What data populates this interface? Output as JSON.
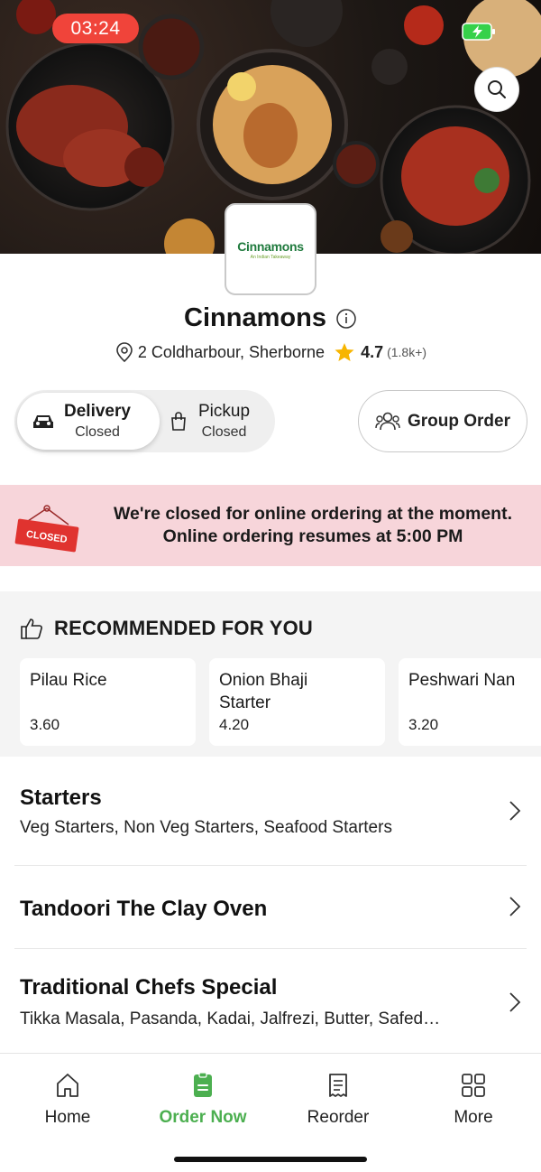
{
  "status_bar": {
    "time": "03:24",
    "battery_icon": "battery-charging-icon",
    "battery_color": "#36d14a"
  },
  "hero": {
    "search_icon": "search-icon"
  },
  "restaurant": {
    "logo_text": "Cinnamons",
    "logo_tagline": "An Indian Takeaway",
    "name": "Cinnamons",
    "address": "2 Coldharbour, Sherborne",
    "rating": "4.7",
    "rating_count": "(1.8k+)",
    "rating_star_color": "#f7b500"
  },
  "order_mode": {
    "delivery": {
      "title": "Delivery",
      "status": "Closed",
      "selected": true
    },
    "pickup": {
      "title": "Pickup",
      "status": "Closed",
      "selected": false
    },
    "group_order_label": "Group Order"
  },
  "closed_banner": {
    "sign_text": "CLOSED",
    "line1": "We're closed for online ordering at the moment.",
    "line2": "Online ordering resumes at 5:00 PM",
    "background": "#f7d5da"
  },
  "recommended": {
    "heading": "RECOMMENDED FOR YOU",
    "items": [
      {
        "name": "Pilau Rice",
        "price": "3.60"
      },
      {
        "name": "Onion Bhaji Starter",
        "price": "4.20"
      },
      {
        "name": "Peshwari Nan",
        "price": "3.20"
      }
    ]
  },
  "categories": [
    {
      "title": "Starters",
      "subtitle": "Veg Starters, Non Veg Starters, Seafood Starters"
    },
    {
      "title": "Tandoori The Clay Oven",
      "subtitle": ""
    },
    {
      "title": "Traditional Chefs Special",
      "subtitle": "Tikka Masala, Pasanda, Kadai, Jalfrezi, Butter, Safed…"
    }
  ],
  "bottom_nav": {
    "items": [
      {
        "label": "Home",
        "icon": "home-icon",
        "active": false
      },
      {
        "label": "Order Now",
        "icon": "order-icon",
        "active": true
      },
      {
        "label": "Reorder",
        "icon": "receipt-icon",
        "active": false
      },
      {
        "label": "More",
        "icon": "grid-icon",
        "active": false
      }
    ],
    "active_color": "#4caf50"
  }
}
